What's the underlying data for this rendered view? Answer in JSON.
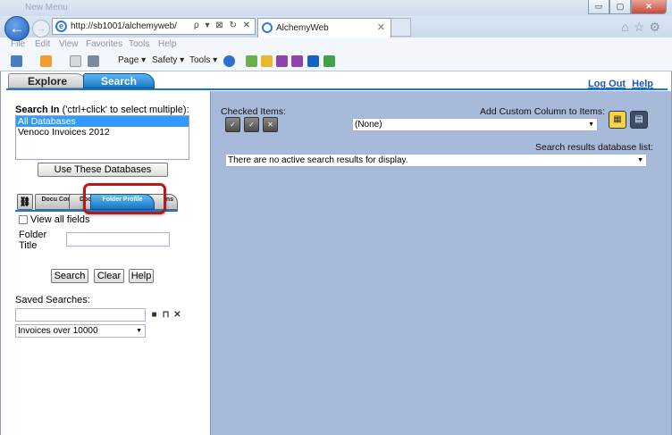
{
  "browser": {
    "title_bar_text": "New Menu",
    "address": "http://sb1001/alchemyweb/",
    "address_tools": "ρ ▾ ⊠ ↻ ✕",
    "tab_title": "AlchemyWeb",
    "tab_close": "✕",
    "menu": [
      "File",
      "Edit",
      "View",
      "Favorites",
      "Tools",
      "Help"
    ],
    "command_bar": [
      "Page ▾",
      "Safety ▾",
      "Tools ▾"
    ],
    "window_controls": {
      "minimize": "▭",
      "maximize": "▢",
      "close": "✕"
    }
  },
  "app": {
    "tabs": {
      "explore": "Explore",
      "search": "Search"
    },
    "links": {
      "logout": "Log Out",
      "help": "Help"
    }
  },
  "left": {
    "search_in_bold": "Search In",
    "search_in_hint": " ('ctrl+click' to select multiple):",
    "databases": [
      "All Databases",
      "Venoco Invoices 2012"
    ],
    "use_databases_button": "Use These Databases",
    "form_tabs": {
      "doc1": "Docu Con",
      "doc2": "Docu F",
      "folder": "Folder Profile",
      "tail": "ns"
    },
    "view_all_fields": "View all fields",
    "folder_title_label_1": "Folder",
    "folder_title_label_2": "Title",
    "folder_title_value": "",
    "buttons": {
      "search": "Search",
      "clear": "Clear",
      "help": "Help"
    },
    "saved_searches_label": "Saved Searches:",
    "saved_search_value": "",
    "saved_search_select": "Invoices over 10000"
  },
  "right": {
    "checked_items_label": "Checked Items:",
    "add_custom_column_label": "Add Custom Column to Items:",
    "custom_column_value": "(None)",
    "results_db_list_label": "Search results database list:",
    "results_value": "There are no active search results for display."
  },
  "colors": {
    "accent_blue": "#1a78c8",
    "right_panel_bg": "#a8bad9",
    "highlight_red": "#b31b1b",
    "selection_blue": "#3399ff",
    "link_blue": "#1a57b8"
  }
}
